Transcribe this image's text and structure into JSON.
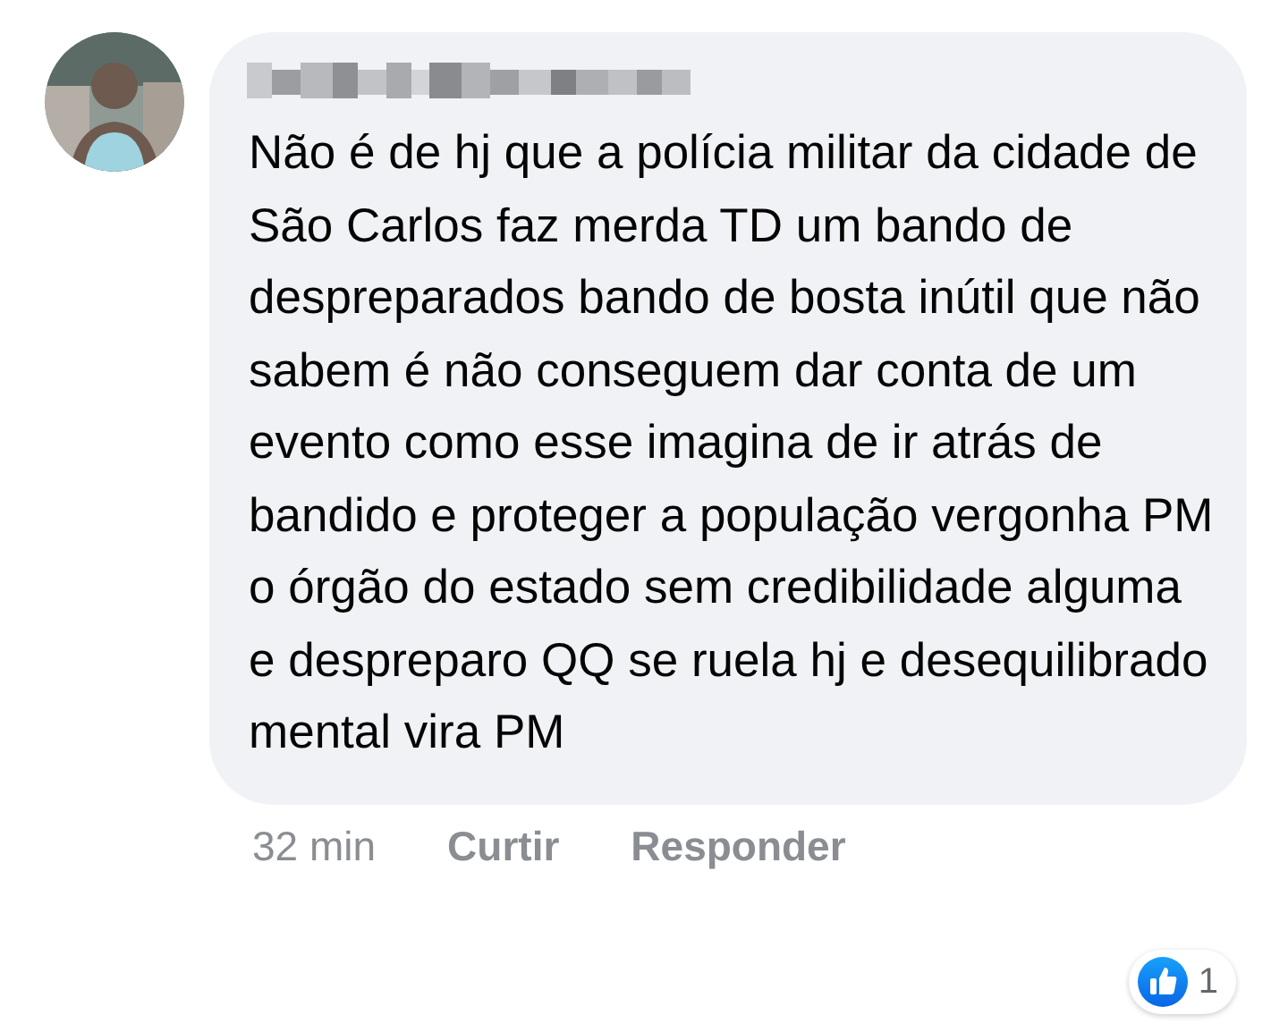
{
  "comment": {
    "text": "Não é de hj que a polícia militar da cidade de São Carlos faz merda TD um bando de despreparados bando de bosta inútil que não sabem é não conseguem dar conta de um evento como esse imagina de ir atrás de bandido e proteger a população vergonha PM o órgão do estado sem credibilidade alguma e despreparo QQ se ruela hj e desequilibrado mental vira PM",
    "time": "32 min",
    "actions": [
      "Curtir",
      "Responder"
    ],
    "reactions": {
      "count": "1"
    }
  }
}
